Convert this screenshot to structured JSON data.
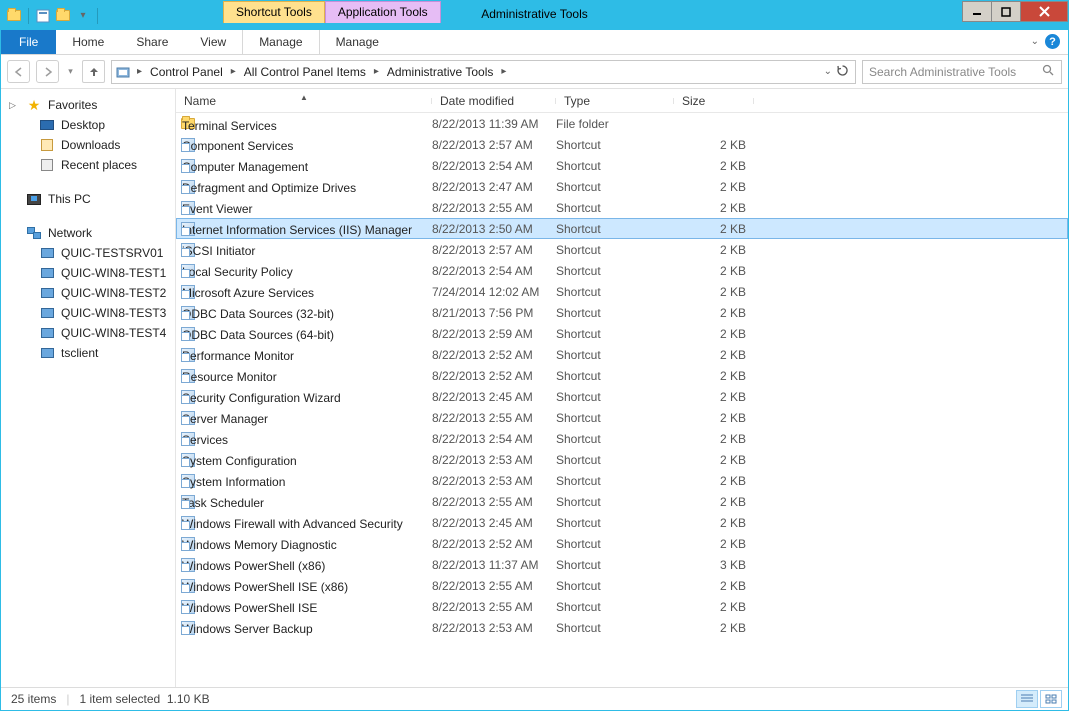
{
  "window": {
    "title": "Administrative Tools"
  },
  "context_tabs": {
    "shortcut": "Shortcut Tools",
    "application": "Application Tools"
  },
  "ribbon": {
    "file": "File",
    "tabs": [
      "Home",
      "Share",
      "View"
    ],
    "manage1": "Manage",
    "manage2": "Manage"
  },
  "breadcrumbs": [
    "Control Panel",
    "All Control Panel Items",
    "Administrative Tools"
  ],
  "search": {
    "placeholder": "Search Administrative Tools"
  },
  "sidebar": {
    "favorites": {
      "label": "Favorites",
      "items": [
        "Desktop",
        "Downloads",
        "Recent places"
      ]
    },
    "thispc": {
      "label": "This PC"
    },
    "network": {
      "label": "Network",
      "items": [
        "QUIC-TESTSRV01",
        "QUIC-WIN8-TEST1",
        "QUIC-WIN8-TEST2",
        "QUIC-WIN8-TEST3",
        "QUIC-WIN8-TEST4",
        "tsclient"
      ]
    }
  },
  "columns": {
    "name": "Name",
    "date": "Date modified",
    "type": "Type",
    "size": "Size"
  },
  "rows": [
    {
      "name": "Terminal Services",
      "date": "8/22/2013 11:39 AM",
      "type": "File folder",
      "size": "",
      "icon": "folder"
    },
    {
      "name": "Component Services",
      "date": "8/22/2013 2:57 AM",
      "type": "Shortcut",
      "size": "2 KB",
      "icon": "shortcut"
    },
    {
      "name": "Computer Management",
      "date": "8/22/2013 2:54 AM",
      "type": "Shortcut",
      "size": "2 KB",
      "icon": "shortcut"
    },
    {
      "name": "Defragment and Optimize Drives",
      "date": "8/22/2013 2:47 AM",
      "type": "Shortcut",
      "size": "2 KB",
      "icon": "shortcut"
    },
    {
      "name": "Event Viewer",
      "date": "8/22/2013 2:55 AM",
      "type": "Shortcut",
      "size": "2 KB",
      "icon": "shortcut"
    },
    {
      "name": "Internet Information Services (IIS) Manager",
      "date": "8/22/2013 2:50 AM",
      "type": "Shortcut",
      "size": "2 KB",
      "icon": "shortcut",
      "selected": true
    },
    {
      "name": "iSCSI Initiator",
      "date": "8/22/2013 2:57 AM",
      "type": "Shortcut",
      "size": "2 KB",
      "icon": "shortcut"
    },
    {
      "name": "Local Security Policy",
      "date": "8/22/2013 2:54 AM",
      "type": "Shortcut",
      "size": "2 KB",
      "icon": "shortcut"
    },
    {
      "name": "Microsoft Azure Services",
      "date": "7/24/2014 12:02 AM",
      "type": "Shortcut",
      "size": "2 KB",
      "icon": "shortcut"
    },
    {
      "name": "ODBC Data Sources (32-bit)",
      "date": "8/21/2013 7:56 PM",
      "type": "Shortcut",
      "size": "2 KB",
      "icon": "shortcut"
    },
    {
      "name": "ODBC Data Sources (64-bit)",
      "date": "8/22/2013 2:59 AM",
      "type": "Shortcut",
      "size": "2 KB",
      "icon": "shortcut"
    },
    {
      "name": "Performance Monitor",
      "date": "8/22/2013 2:52 AM",
      "type": "Shortcut",
      "size": "2 KB",
      "icon": "shortcut"
    },
    {
      "name": "Resource Monitor",
      "date": "8/22/2013 2:52 AM",
      "type": "Shortcut",
      "size": "2 KB",
      "icon": "shortcut"
    },
    {
      "name": "Security Configuration Wizard",
      "date": "8/22/2013 2:45 AM",
      "type": "Shortcut",
      "size": "2 KB",
      "icon": "shortcut"
    },
    {
      "name": "Server Manager",
      "date": "8/22/2013 2:55 AM",
      "type": "Shortcut",
      "size": "2 KB",
      "icon": "shortcut"
    },
    {
      "name": "Services",
      "date": "8/22/2013 2:54 AM",
      "type": "Shortcut",
      "size": "2 KB",
      "icon": "shortcut"
    },
    {
      "name": "System Configuration",
      "date": "8/22/2013 2:53 AM",
      "type": "Shortcut",
      "size": "2 KB",
      "icon": "shortcut"
    },
    {
      "name": "System Information",
      "date": "8/22/2013 2:53 AM",
      "type": "Shortcut",
      "size": "2 KB",
      "icon": "shortcut"
    },
    {
      "name": "Task Scheduler",
      "date": "8/22/2013 2:55 AM",
      "type": "Shortcut",
      "size": "2 KB",
      "icon": "shortcut"
    },
    {
      "name": "Windows Firewall with Advanced Security",
      "date": "8/22/2013 2:45 AM",
      "type": "Shortcut",
      "size": "2 KB",
      "icon": "shortcut"
    },
    {
      "name": "Windows Memory Diagnostic",
      "date": "8/22/2013 2:52 AM",
      "type": "Shortcut",
      "size": "2 KB",
      "icon": "shortcut"
    },
    {
      "name": "Windows PowerShell (x86)",
      "date": "8/22/2013 11:37 AM",
      "type": "Shortcut",
      "size": "3 KB",
      "icon": "shortcut"
    },
    {
      "name": "Windows PowerShell ISE (x86)",
      "date": "8/22/2013 2:55 AM",
      "type": "Shortcut",
      "size": "2 KB",
      "icon": "shortcut"
    },
    {
      "name": "Windows PowerShell ISE",
      "date": "8/22/2013 2:55 AM",
      "type": "Shortcut",
      "size": "2 KB",
      "icon": "shortcut"
    },
    {
      "name": "Windows Server Backup",
      "date": "8/22/2013 2:53 AM",
      "type": "Shortcut",
      "size": "2 KB",
      "icon": "shortcut"
    }
  ],
  "status": {
    "count": "25 items",
    "selection": "1 item selected",
    "size": "1.10 KB"
  }
}
